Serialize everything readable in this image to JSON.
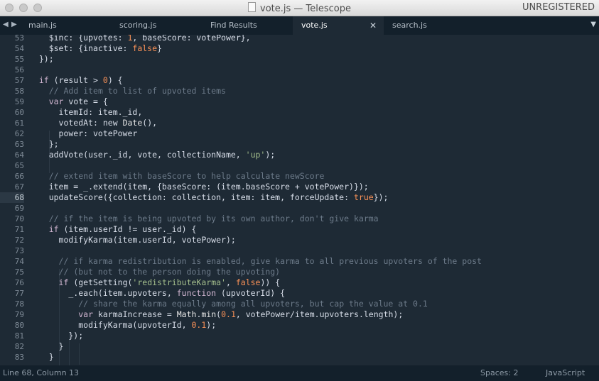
{
  "window": {
    "title": "vote.js — Telescope",
    "license": "UNREGISTERED",
    "nav_back": "◀",
    "nav_forward": "▶",
    "tab_close": "✕",
    "tab_dropdown": "▼"
  },
  "tabs": [
    {
      "label": "main.js",
      "active": false
    },
    {
      "label": "scoring.js",
      "active": false
    },
    {
      "label": "Find Results",
      "active": false
    },
    {
      "label": "vote.js",
      "active": true
    },
    {
      "label": "search.js",
      "active": false
    }
  ],
  "editor": {
    "current_line": 68,
    "lines": [
      {
        "n": "53",
        "tokens": [
          [
            "",
            "    $inc: {upvotes: "
          ],
          [
            "num",
            "1"
          ],
          [
            "",
            ", baseScore: votePower},"
          ]
        ]
      },
      {
        "n": "54",
        "tokens": [
          [
            "",
            "    $set: {inactive: "
          ],
          [
            "bool",
            "false"
          ],
          [
            "",
            "}"
          ]
        ]
      },
      {
        "n": "55",
        "tokens": [
          [
            "",
            "  });"
          ]
        ]
      },
      {
        "n": "56",
        "tokens": [
          [
            "",
            ""
          ]
        ]
      },
      {
        "n": "57",
        "tokens": [
          [
            "",
            "  "
          ],
          [
            "kw",
            "if"
          ],
          [
            "",
            " (result > "
          ],
          [
            "num",
            "0"
          ],
          [
            "",
            ") {"
          ]
        ]
      },
      {
        "n": "58",
        "tokens": [
          [
            "",
            "    "
          ],
          [
            "cmt",
            "// Add item to list of upvoted items"
          ]
        ]
      },
      {
        "n": "59",
        "tokens": [
          [
            "",
            "    "
          ],
          [
            "kw",
            "var"
          ],
          [
            "",
            " vote = {"
          ]
        ]
      },
      {
        "n": "60",
        "tokens": [
          [
            "",
            "      itemId: item._id,"
          ]
        ]
      },
      {
        "n": "61",
        "tokens": [
          [
            "",
            "      votedAt: new "
          ],
          [
            "fn",
            "Date"
          ],
          [
            "",
            "(),"
          ]
        ]
      },
      {
        "n": "62",
        "tokens": [
          [
            "",
            "      power: votePower"
          ]
        ]
      },
      {
        "n": "63",
        "tokens": [
          [
            "",
            "    };"
          ]
        ]
      },
      {
        "n": "64",
        "tokens": [
          [
            "",
            "    addVote(user._id, vote, collectionName, "
          ],
          [
            "str",
            "'up'"
          ],
          [
            "",
            ");"
          ]
        ]
      },
      {
        "n": "65",
        "tokens": [
          [
            "",
            ""
          ]
        ]
      },
      {
        "n": "66",
        "tokens": [
          [
            "",
            "    "
          ],
          [
            "cmt",
            "// extend item with baseScore to help calculate newScore"
          ]
        ]
      },
      {
        "n": "67",
        "tokens": [
          [
            "",
            "    item = _.extend(item, {baseScore: (item.baseScore + votePower)});"
          ]
        ]
      },
      {
        "n": "68",
        "tokens": [
          [
            "",
            "    updateScore({collection: collection, item: item, forceUpdate: "
          ],
          [
            "bool",
            "true"
          ],
          [
            "",
            "});"
          ]
        ]
      },
      {
        "n": "69",
        "tokens": [
          [
            "",
            ""
          ]
        ]
      },
      {
        "n": "70",
        "tokens": [
          [
            "",
            "    "
          ],
          [
            "cmt",
            "// if the item is being upvoted by its own author, don't give karma"
          ]
        ]
      },
      {
        "n": "71",
        "tokens": [
          [
            "",
            "    "
          ],
          [
            "kw",
            "if"
          ],
          [
            "",
            " (item.userId != user._id) {"
          ]
        ]
      },
      {
        "n": "72",
        "tokens": [
          [
            "",
            "      modifyKarma(item.userId, votePower);"
          ]
        ]
      },
      {
        "n": "73",
        "tokens": [
          [
            "",
            ""
          ]
        ]
      },
      {
        "n": "74",
        "tokens": [
          [
            "",
            "      "
          ],
          [
            "cmt",
            "// if karma redistribution is enabled, give karma to all previous upvoters of the post"
          ]
        ]
      },
      {
        "n": "75",
        "tokens": [
          [
            "",
            "      "
          ],
          [
            "cmt",
            "// (but not to the person doing the upvoting)"
          ]
        ]
      },
      {
        "n": "76",
        "tokens": [
          [
            "",
            "      "
          ],
          [
            "kw",
            "if"
          ],
          [
            "",
            " (getSetting("
          ],
          [
            "str",
            "'redistributeKarma'"
          ],
          [
            "",
            ", "
          ],
          [
            "bool",
            "false"
          ],
          [
            "",
            ")) {"
          ]
        ]
      },
      {
        "n": "77",
        "tokens": [
          [
            "",
            "        _.each(item.upvoters, "
          ],
          [
            "kw",
            "function"
          ],
          [
            "",
            " (upvoterId) {"
          ]
        ]
      },
      {
        "n": "78",
        "tokens": [
          [
            "",
            "          "
          ],
          [
            "cmt",
            "// share the karma equally among all upvoters, but cap the value at 0.1"
          ]
        ]
      },
      {
        "n": "79",
        "tokens": [
          [
            "",
            "          "
          ],
          [
            "kw",
            "var"
          ],
          [
            "",
            " karmaIncrease = "
          ],
          [
            "fn",
            "Math"
          ],
          [
            "",
            "."
          ],
          [
            "fn",
            "min"
          ],
          [
            "",
            "("
          ],
          [
            "num",
            "0.1"
          ],
          [
            "",
            ", votePower/item.upvoters.length);"
          ]
        ]
      },
      {
        "n": "80",
        "tokens": [
          [
            "",
            "          modifyKarma(upvoterId, "
          ],
          [
            "num",
            "0.1"
          ],
          [
            "",
            ");"
          ]
        ]
      },
      {
        "n": "81",
        "tokens": [
          [
            "",
            "        });"
          ]
        ]
      },
      {
        "n": "82",
        "tokens": [
          [
            "",
            "      }"
          ]
        ]
      },
      {
        "n": "83",
        "tokens": [
          [
            "",
            "    }"
          ]
        ]
      }
    ]
  },
  "status": {
    "position": "Line 68, Column 13",
    "indentation": "Spaces: 2",
    "syntax": "JavaScript"
  }
}
